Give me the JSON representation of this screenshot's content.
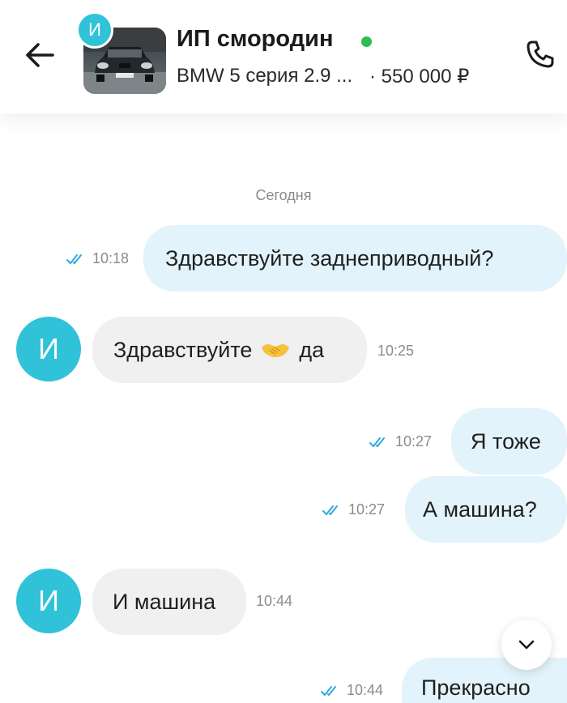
{
  "header": {
    "back_icon": "arrow-left-icon",
    "seller_initial": "И",
    "seller_name": "ИП смородин",
    "online_color": "#2ebd4f",
    "listing_title": "BMW 5 серия 2.9 ...",
    "listing_price": "· 550 000 ₽",
    "call_icon": "phone-icon"
  },
  "chat": {
    "day_label": "Сегодня",
    "accent": "#2fc2d9",
    "messages": [
      {
        "direction": "out",
        "text": "Здравствуйте заднеприводный?",
        "time": "10:18",
        "read": true
      },
      {
        "direction": "in",
        "sender_initial": "И",
        "text_before": "Здравствуйте",
        "emoji": "handshake-emoji",
        "text_after": "да",
        "time": "10:25"
      },
      {
        "direction": "out",
        "text": "Я тоже",
        "time": "10:27",
        "read": true
      },
      {
        "direction": "out",
        "text": "А машина?",
        "time": "10:27",
        "read": true
      },
      {
        "direction": "in",
        "sender_initial": "И",
        "text": "И машина",
        "time": "10:44"
      },
      {
        "direction": "out",
        "text": "Прекрасно",
        "time": "10:44",
        "read": true
      }
    ],
    "scroll_icon": "chevron-down-icon"
  }
}
